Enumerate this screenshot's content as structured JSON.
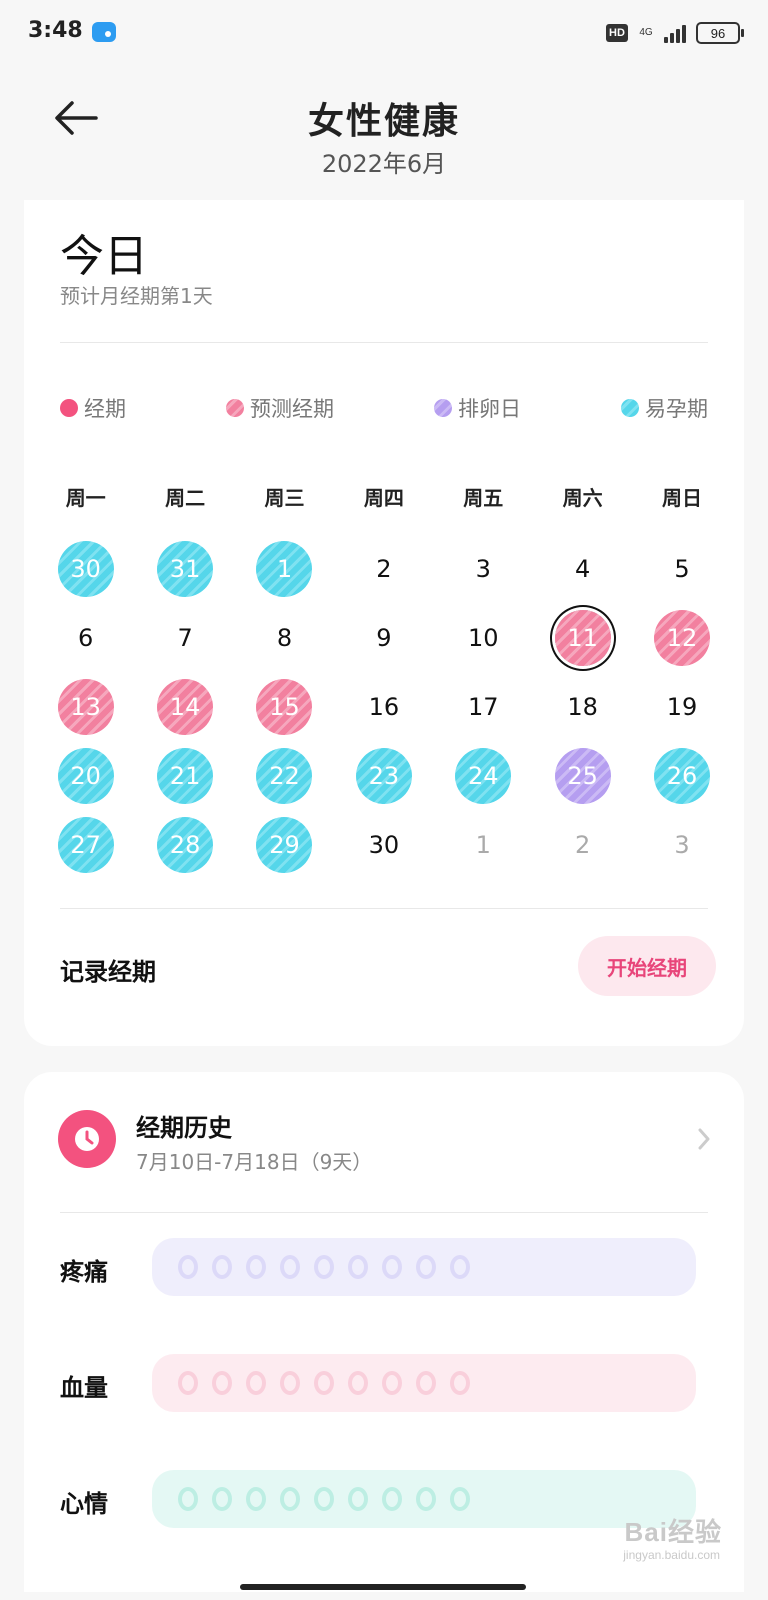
{
  "status_bar": {
    "time": "3:48",
    "hd": "HD",
    "network": "4G",
    "battery": "96"
  },
  "header": {
    "title": "女性健康",
    "subtitle": "2022年6月",
    "back_icon": "arrow-left-icon"
  },
  "today": {
    "title": "今日",
    "subtitle": "预计月经期第1天"
  },
  "legend": [
    {
      "label": "经期",
      "color": "#f3527f",
      "style": "solid"
    },
    {
      "label": "预测经期",
      "color": "#f2809f",
      "style": "striped"
    },
    {
      "label": "排卵日",
      "color": "#b59ef0",
      "style": "striped"
    },
    {
      "label": "易孕期",
      "color": "#55d6ea",
      "style": "striped"
    }
  ],
  "weekdays": [
    "周一",
    "周二",
    "周三",
    "周四",
    "周五",
    "周六",
    "周日"
  ],
  "calendar": [
    {
      "d": "30",
      "t": "fertile"
    },
    {
      "d": "31",
      "t": "fertile"
    },
    {
      "d": "1",
      "t": "fertile"
    },
    {
      "d": "2",
      "t": ""
    },
    {
      "d": "3",
      "t": ""
    },
    {
      "d": "4",
      "t": ""
    },
    {
      "d": "5",
      "t": ""
    },
    {
      "d": "6",
      "t": ""
    },
    {
      "d": "7",
      "t": ""
    },
    {
      "d": "8",
      "t": ""
    },
    {
      "d": "9",
      "t": ""
    },
    {
      "d": "10",
      "t": ""
    },
    {
      "d": "11",
      "t": "predicted",
      "today": true
    },
    {
      "d": "12",
      "t": "predicted"
    },
    {
      "d": "13",
      "t": "predicted"
    },
    {
      "d": "14",
      "t": "predicted"
    },
    {
      "d": "15",
      "t": "predicted"
    },
    {
      "d": "16",
      "t": ""
    },
    {
      "d": "17",
      "t": ""
    },
    {
      "d": "18",
      "t": ""
    },
    {
      "d": "19",
      "t": ""
    },
    {
      "d": "20",
      "t": "fertile"
    },
    {
      "d": "21",
      "t": "fertile"
    },
    {
      "d": "22",
      "t": "fertile"
    },
    {
      "d": "23",
      "t": "fertile"
    },
    {
      "d": "24",
      "t": "fertile"
    },
    {
      "d": "25",
      "t": "ovulation"
    },
    {
      "d": "26",
      "t": "fertile"
    },
    {
      "d": "27",
      "t": "fertile"
    },
    {
      "d": "28",
      "t": "fertile"
    },
    {
      "d": "29",
      "t": "fertile"
    },
    {
      "d": "30",
      "t": ""
    },
    {
      "d": "1",
      "t": "muted"
    },
    {
      "d": "2",
      "t": "muted"
    },
    {
      "d": "3",
      "t": "muted"
    }
  ],
  "record": {
    "label": "记录经期",
    "button": "开始经期"
  },
  "history": {
    "title": "经期历史",
    "range": "7月10日-7月18日（9天）",
    "icon": "clock-icon"
  },
  "ratings": [
    {
      "label": "疼痛",
      "key": "pain",
      "count": 9,
      "level": 0
    },
    {
      "label": "血量",
      "key": "flow",
      "count": 9,
      "level": 0
    },
    {
      "label": "心情",
      "key": "mood",
      "count": 9,
      "level": 0
    }
  ],
  "watermark": {
    "text": "Bai经验",
    "sub": "jingyan.baidu.com"
  }
}
